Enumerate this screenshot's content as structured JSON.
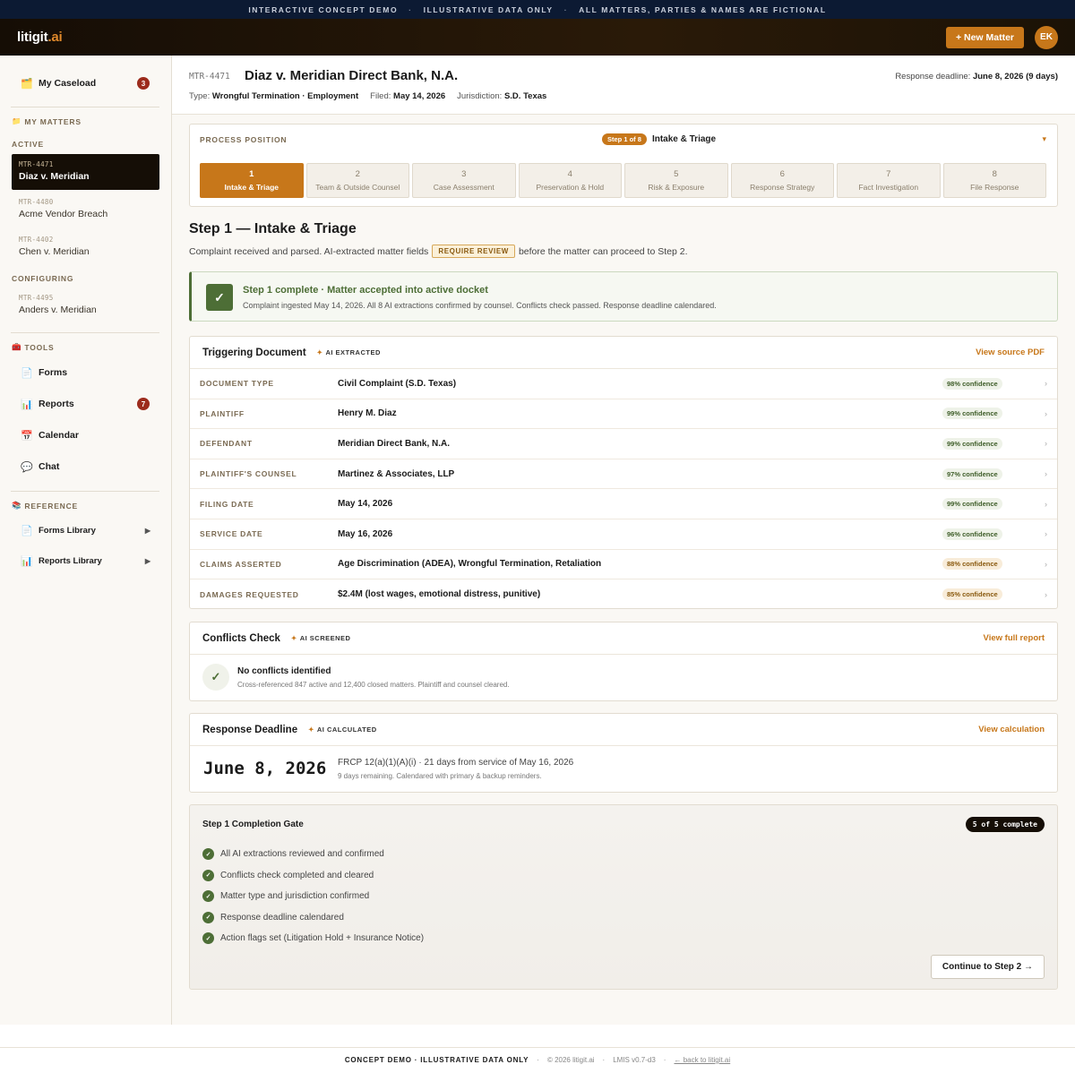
{
  "banner": {
    "items": [
      "INTERACTIVE CONCEPT DEMO",
      "ILLUSTRATIVE DATA ONLY",
      "ALL MATTERS, PARTIES & NAMES ARE FICTIONAL"
    ],
    "sep": "·"
  },
  "header": {
    "logo_main": "litigit",
    "logo_ai": ".ai",
    "new_matter": "+ New Matter",
    "avatar": "EK"
  },
  "sidebar": {
    "caseload": {
      "label": "My Caseload",
      "count": "3",
      "icon": "folder-icon"
    },
    "my_matters": "MY MATTERS",
    "active_label": "ACTIVE",
    "active_matters": [
      {
        "id": "MTR-4471",
        "name": "Diaz v. Meridian"
      },
      {
        "id": "MTR-4480",
        "name": "Acme Vendor Breach"
      },
      {
        "id": "MTR-4402",
        "name": "Chen v. Meridian"
      }
    ],
    "configuring_label": "CONFIGURING",
    "configuring_matters": [
      {
        "id": "MTR-4495",
        "name": "Anders v. Meridian"
      }
    ],
    "tools_label": "TOOLS",
    "tools": [
      {
        "label": "Forms",
        "icon": "document-icon"
      },
      {
        "label": "Reports",
        "icon": "chart-icon",
        "count": "7"
      },
      {
        "label": "Calendar",
        "icon": "calendar-icon"
      },
      {
        "label": "Chat",
        "icon": "chat-icon"
      }
    ],
    "reference_label": "REFERENCE",
    "reference": [
      {
        "label": "Forms Library",
        "icon": "document-icon"
      },
      {
        "label": "Reports Library",
        "icon": "chart-icon"
      }
    ]
  },
  "matter": {
    "id": "MTR-4471",
    "title": "Diaz v. Meridian Direct Bank, N.A.",
    "deadline_label": "Response deadline:",
    "deadline_value": "June 8, 2026 (9 days)",
    "type_label": "Type:",
    "type_value": "Wrongful Termination · Employment",
    "filed_label": "Filed:",
    "filed_value": "May 14, 2026",
    "jurisdiction_label": "Jurisdiction:",
    "jurisdiction_value": "S.D. Texas"
  },
  "process": {
    "label": "PROCESS POSITION",
    "pill": "Step 1 of 8",
    "current": "Intake & Triage",
    "chevron": "▾",
    "steps": [
      {
        "num": "1",
        "label": "Intake & Triage"
      },
      {
        "num": "2",
        "label": "Team & Outside Counsel"
      },
      {
        "num": "3",
        "label": "Case Assessment"
      },
      {
        "num": "4",
        "label": "Preservation & Hold"
      },
      {
        "num": "5",
        "label": "Risk & Exposure"
      },
      {
        "num": "6",
        "label": "Response Strategy"
      },
      {
        "num": "7",
        "label": "Fact Investigation"
      },
      {
        "num": "8",
        "label": "File Response"
      }
    ]
  },
  "step": {
    "title": "Step 1 — Intake & Triage",
    "desc_before": "Complaint received and parsed. AI-extracted matter fields",
    "desc_badge": "REQUIRE REVIEW",
    "desc_after": "before the matter can proceed to Step 2."
  },
  "complete_banner": {
    "title": "Step 1 complete · Matter accepted into active docket",
    "sub": "Complaint ingested May 14, 2026. All 8 AI extractions confirmed by counsel. Conflicts check passed. Response deadline calendared."
  },
  "triggering": {
    "title": "Triggering Document",
    "tag": "AI EXTRACTED",
    "link": "View source PDF",
    "rows": [
      {
        "label": "DOCUMENT TYPE",
        "value": "Civil Complaint (S.D. Texas)",
        "conf": "98% confidence"
      },
      {
        "label": "PLAINTIFF",
        "value": "Henry M. Diaz",
        "conf": "99% confidence"
      },
      {
        "label": "DEFENDANT",
        "value": "Meridian Direct Bank, N.A.",
        "conf": "99% confidence"
      },
      {
        "label": "PLAINTIFF'S COUNSEL",
        "value": "Martinez & Associates, LLP",
        "conf": "97% confidence"
      },
      {
        "label": "FILING DATE",
        "value": "May 14, 2026",
        "conf": "99% confidence"
      },
      {
        "label": "SERVICE DATE",
        "value": "May 16, 2026",
        "conf": "96% confidence"
      },
      {
        "label": "CLAIMS ASSERTED",
        "value": "Age Discrimination (ADEA), Wrongful Termination, Retaliation",
        "conf": "88% confidence"
      },
      {
        "label": "DAMAGES REQUESTED",
        "value": "$2.4M (lost wages, emotional distress, punitive)",
        "conf": "85% confidence"
      }
    ]
  },
  "conflicts": {
    "title": "Conflicts Check",
    "tag": "AI SCREENED",
    "link": "View full report",
    "result": "No conflicts identified",
    "detail": "Cross-referenced 847 active and 12,400 closed matters. Plaintiff and counsel cleared."
  },
  "deadline": {
    "title": "Response Deadline",
    "tag": "AI CALCULATED",
    "link": "View calculation",
    "date": "June 8, 2026",
    "rule": "FRCP 12(a)(1)(A)(i) · 21 days from service of May 16, 2026",
    "detail": "9 days remaining. Calendared with primary & backup reminders."
  },
  "gate": {
    "title": "Step 1 Completion Gate",
    "pill": "5 of 5 complete",
    "items": [
      "All AI extractions reviewed and confirmed",
      "Conflicts check completed and cleared",
      "Matter type and jurisdiction confirmed",
      "Response deadline calendared",
      "Action flags set (Litigation Hold + Insurance Notice)"
    ],
    "button": "Continue to Step 2 →"
  },
  "footer": {
    "label": "CONCEPT DEMO · ILLUSTRATIVE DATA ONLY",
    "copyright": "© 2026 litigit.ai",
    "version": "LMIS v0.7-d3",
    "back": "← back to litigit.ai",
    "sep": "·"
  },
  "colors": {
    "accent": "#c7771a",
    "banner_bg": "#0c1a33",
    "success": "#4d6e36",
    "badge_red": "#9c2b1c"
  }
}
